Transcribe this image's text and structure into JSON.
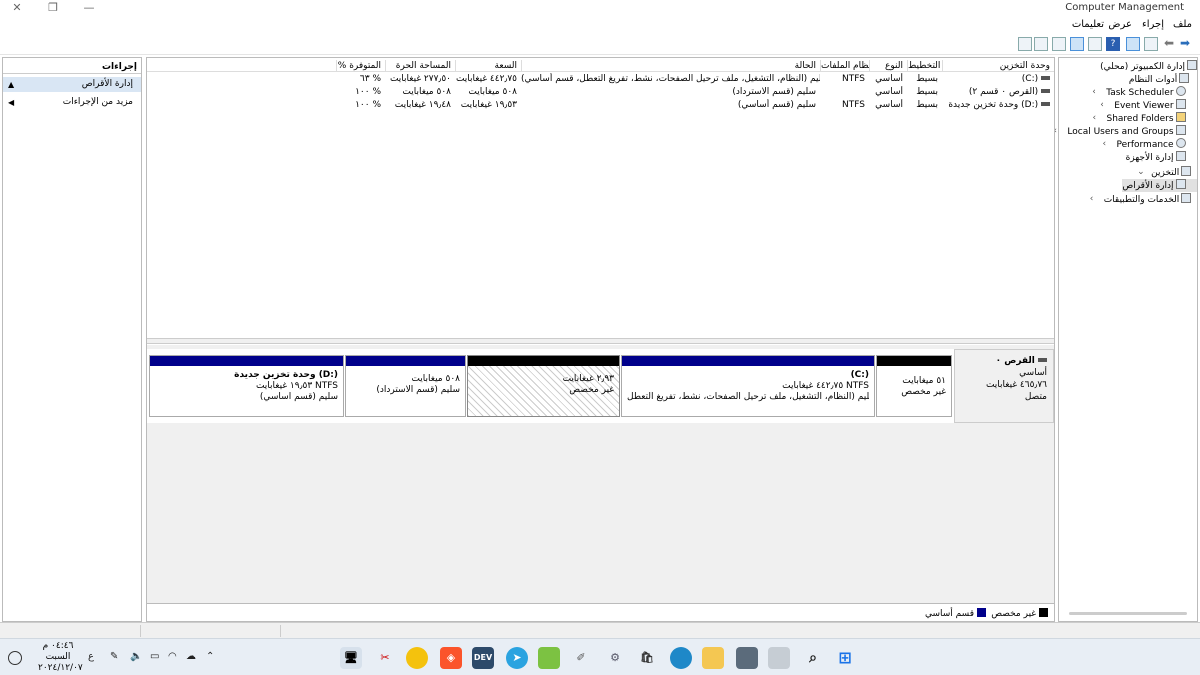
{
  "window": {
    "title": "Computer Management"
  },
  "menubar": {
    "file": "ملف",
    "action": "إجراء",
    "view": "عرض",
    "help": "تعليمات"
  },
  "tree": {
    "root": "إدارة الكمبيوتر (محلي)",
    "system_tools": "أدوات النظام",
    "task_scheduler": "Task Scheduler",
    "event_viewer": "Event Viewer",
    "shared_folders": "Shared Folders",
    "local_users": "Local Users and Groups",
    "performance": "Performance",
    "device_manager": "إدارة الأجهزة",
    "storage": "التخزين",
    "disk_management": "إدارة الأقراص",
    "services": "الخدمات والتطبيقات"
  },
  "volumes": {
    "headers": {
      "volume": "وحدة التخزين",
      "layout": "التخطيط",
      "type": "النوع",
      "fs": "نظام الملفات",
      "status": "الحالة",
      "capacity": "السعة",
      "free": "المساحة الحرة",
      "pct": "% المتوفرة"
    },
    "rows": [
      {
        "volume": "(C:)",
        "layout": "بسيط",
        "type": "أساسي",
        "fs": "NTFS",
        "status": "سليم (النظام، التشغيل، ملف ترحيل الصفحات، نشط، تفريغ التعطل، قسم أساسي)",
        "capacity": "٤٤٢٫٧٥ غيغابايت",
        "free": "٢٧٧٫٥٠ غيغابايت",
        "pct": "٦٣ %"
      },
      {
        "volume": "(القرص ٠ قسم ٢)",
        "layout": "بسيط",
        "type": "أساسي",
        "fs": "",
        "status": "سليم (قسم الاسترداد)",
        "capacity": "٥٠٨ ميغابايت",
        "free": "٥٠٨ ميغابايت",
        "pct": "١٠٠ %"
      },
      {
        "volume": "وحدة تخزين جديدة (D:)",
        "layout": "بسيط",
        "type": "أساسي",
        "fs": "NTFS",
        "status": "سليم (قسم أساسي)",
        "capacity": "١٩٫٥٣ غيغابايت",
        "free": "١٩٫٤٨ غيغابايت",
        "pct": "١٠٠ %"
      }
    ]
  },
  "disk": {
    "name": "القرص ٠",
    "type": "أساسي",
    "size": "٤٦٥٫٧٦ غيغابايت",
    "status": "متصل",
    "partitions": [
      {
        "line1": "٥١ ميغابايت",
        "line2": "غير مخصص",
        "line3": ""
      },
      {
        "line1": "(C:)",
        "line2": "٤٤٢٫٧٥ غيغابايت NTFS",
        "line3": "سليم (النظام، التشغيل، ملف ترحيل الصفحات، نشط، تفريغ التعطل،"
      },
      {
        "line1": "٢٫٩٣ غيغابايت",
        "line2": "غير مخصص",
        "line3": ""
      },
      {
        "line1": "٥٠٨ ميغابايت",
        "line2": "سليم (قسم الاسترداد)",
        "line3": ""
      },
      {
        "line1": "وحدة تخزين جديدة  (D:)",
        "line2": "١٩٫٥٣ غيغابايت NTFS",
        "line3": "سليم (قسم أساسي)"
      }
    ]
  },
  "legend": {
    "unallocated": "غير مخصص",
    "primary": "قسم أساسي"
  },
  "colors": {
    "primary": "#00008b",
    "unallocated": "#000000"
  },
  "actions": {
    "title": "إجراءات",
    "section": "إدارة الأقراص",
    "more": "مزيد من الإجراءات"
  },
  "taskbar": {
    "clock_time": "٠٤:٤٦ م",
    "clock_day": "السبت",
    "clock_date": "٢٠٢٤/١٢/٠٧",
    "lang": "ع",
    "dev_label": "DEV"
  }
}
